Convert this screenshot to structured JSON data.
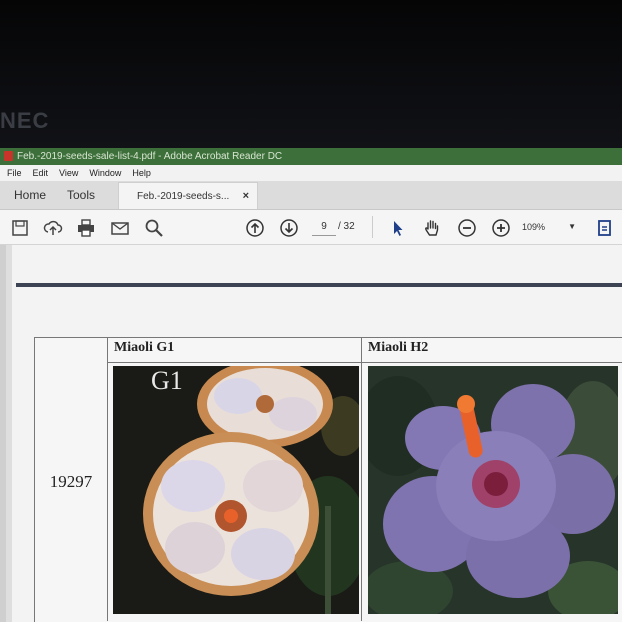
{
  "monitor": {
    "brand": "NEC"
  },
  "window": {
    "title": "Feb.-2019-seeds-sale-list-4.pdf - Adobe Acrobat Reader DC"
  },
  "menu": [
    "File",
    "Edit",
    "View",
    "Window",
    "Help"
  ],
  "tabs": {
    "home": "Home",
    "tools": "Tools",
    "document": "Feb.-2019-seeds-s...",
    "close": "×"
  },
  "toolbar": {
    "page_current": "9",
    "page_total": "/ 32",
    "zoom": "109%",
    "icons": [
      "save-icon",
      "upload-icon",
      "print-icon",
      "email-icon",
      "search-icon",
      "page-up-icon",
      "page-down-icon",
      "select-arrow-icon",
      "hand-icon",
      "zoom-out-icon",
      "zoom-in-icon",
      "fit-page-icon"
    ]
  },
  "document": {
    "row_id": "19297",
    "cells": [
      {
        "name": "Miaoli G1",
        "photo_label": "G1"
      },
      {
        "name": "Miaoli H2"
      }
    ]
  },
  "colors": {
    "titlebar": "#3c6f3a",
    "rule": "#3c4353",
    "flower_a_petal": "#e8d9cc",
    "flower_b_petal": "#8377b4",
    "stamen": "#e9612a"
  }
}
